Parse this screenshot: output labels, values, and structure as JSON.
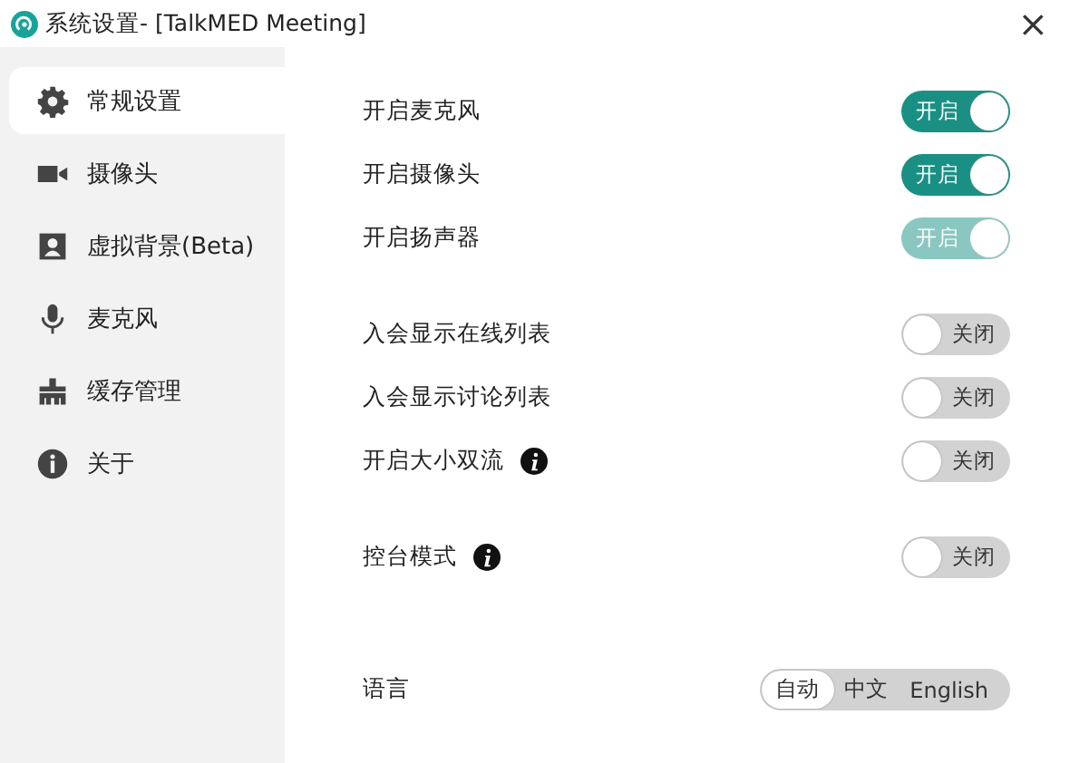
{
  "window": {
    "title": "系统设置- [TalkMED Meeting]",
    "close": "×"
  },
  "sidebar": {
    "items": [
      {
        "label": "常规设置",
        "selected": true
      },
      {
        "label": "摄像头",
        "selected": false
      },
      {
        "label": "虚拟背景(Beta)",
        "selected": false
      },
      {
        "label": "麦克风",
        "selected": false
      },
      {
        "label": "缓存管理",
        "selected": false
      },
      {
        "label": "关于",
        "selected": false
      }
    ]
  },
  "settings": {
    "groups": [
      {
        "rows": [
          {
            "kind": "toggle",
            "label": "开启麦克风",
            "info": false,
            "on": true,
            "disabled": false,
            "state_text": "开启"
          },
          {
            "kind": "toggle",
            "label": "开启摄像头",
            "info": false,
            "on": true,
            "disabled": false,
            "state_text": "开启"
          },
          {
            "kind": "toggle",
            "label": "开启扬声器",
            "info": false,
            "on": true,
            "disabled": true,
            "state_text": "开启"
          }
        ]
      },
      {
        "rows": [
          {
            "kind": "toggle",
            "label": "入会显示在线列表",
            "info": false,
            "on": false,
            "disabled": false,
            "state_text": "关闭"
          },
          {
            "kind": "toggle",
            "label": "入会显示讨论列表",
            "info": false,
            "on": false,
            "disabled": false,
            "state_text": "关闭"
          },
          {
            "kind": "toggle",
            "label": "开启大小双流",
            "info": true,
            "on": false,
            "disabled": false,
            "state_text": "关闭"
          }
        ]
      },
      {
        "rows": [
          {
            "kind": "toggle",
            "label": "控台模式",
            "info": true,
            "on": false,
            "disabled": false,
            "state_text": "关闭"
          }
        ]
      },
      {
        "rows": [
          {
            "kind": "segmented",
            "label": "语言",
            "info": false,
            "options": [
              {
                "label": "自动",
                "selected": true
              },
              {
                "label": "中文",
                "selected": false
              },
              {
                "label": "English",
                "selected": false
              }
            ]
          }
        ]
      }
    ]
  }
}
